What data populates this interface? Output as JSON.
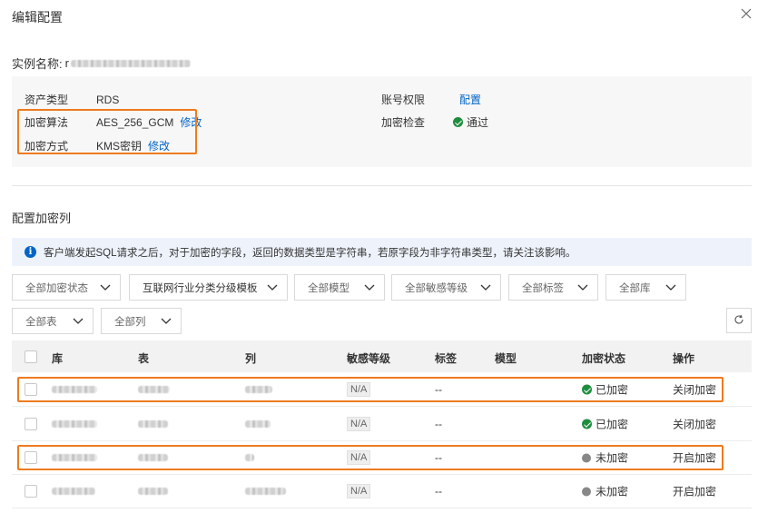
{
  "dialog": {
    "title": "编辑配置"
  },
  "instance": {
    "label": "实例名称:",
    "name_prefix": "r"
  },
  "info": {
    "asset_type_label": "资产类型",
    "asset_type_value": "RDS",
    "account_perm_label": "账号权限",
    "account_perm_link": "配置",
    "algo_label": "加密算法",
    "algo_value": "AES_256_GCM",
    "algo_modify": "修改",
    "check_label": "加密检查",
    "check_value": "通过",
    "method_label": "加密方式",
    "method_value": "KMS密钥",
    "method_modify": "修改"
  },
  "section": {
    "title": "配置加密列"
  },
  "notice": {
    "text": "客户端发起SQL请求之后，对于加密的字段，返回的数据类型是字符串，若原字段为非字符串类型，请关注该影响。"
  },
  "filters": {
    "status": "全部加密状态",
    "template": "互联网行业分类分级模板",
    "model": "全部模型",
    "sensitivity": "全部敏感等级",
    "tag": "全部标签",
    "db": "全部库",
    "table": "全部表",
    "column": "全部列"
  },
  "table": {
    "headers": {
      "db": "库",
      "table": "表",
      "column": "列",
      "level": "敏感等级",
      "tag": "标签",
      "model": "模型",
      "status": "加密状态",
      "action": "操作"
    },
    "rows": [
      {
        "level": "N/A",
        "tag": "--",
        "status": "已加密",
        "status_color": "#1e8e3e",
        "action": "关闭加密"
      },
      {
        "level": "N/A",
        "tag": "--",
        "status": "已加密",
        "status_color": "#1e8e3e",
        "action": "关闭加密"
      },
      {
        "level": "N/A",
        "tag": "--",
        "status": "未加密",
        "status_color": "#888888",
        "action": "开启加密"
      },
      {
        "level": "N/A",
        "tag": "--",
        "status": "未加密",
        "status_color": "#888888",
        "action": "开启加密"
      }
    ]
  },
  "colors": {
    "accent": "#0064c8",
    "highlight": "#ef7b1e",
    "success": "#1e8e3e"
  }
}
